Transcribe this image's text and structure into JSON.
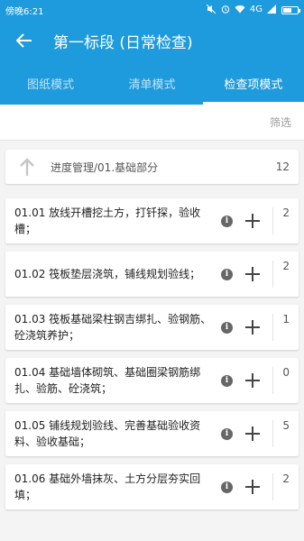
{
  "statusbar": {
    "time": "傍晚6:21",
    "network": "4G",
    "icons": [
      "mute-icon",
      "alarm-icon",
      "wifi-icon",
      "signal-icon",
      "battery-icon"
    ]
  },
  "appbar": {
    "title": "第一标段 (日常检查)",
    "back_icon": "arrow-left-icon"
  },
  "tabs": [
    {
      "label": "图纸模式",
      "active": false
    },
    {
      "label": "清单模式",
      "active": false
    },
    {
      "label": "检查项模式",
      "active": true
    }
  ],
  "filter": {
    "label": "筛选"
  },
  "breadcrumb": {
    "path": "进度管理/01.基础部分",
    "count": "12"
  },
  "items": [
    {
      "text": "01.01 放线开槽挖土方，打钎探，验收槽；",
      "count": "2"
    },
    {
      "text": "01.02 筏板垫层浇筑，铺线规划验线；",
      "count": "2"
    },
    {
      "text": "01.03 筏板基础梁柱钢吉绑扎、验钢筋、砼浇筑养护；",
      "count": "1"
    },
    {
      "text": "01.04 基础墙体砌筑、基础圈梁钢筋绑扎、验筋、砼浇筑；",
      "count": "0"
    },
    {
      "text": "01.05 铺线规划验线、完善基础验收资料、验收基础；",
      "count": "5"
    },
    {
      "text": "01.06 基础外墙抹灰、土方分层夯实回填；",
      "count": "2"
    }
  ],
  "colors": {
    "primary": "#1e9bdc"
  }
}
